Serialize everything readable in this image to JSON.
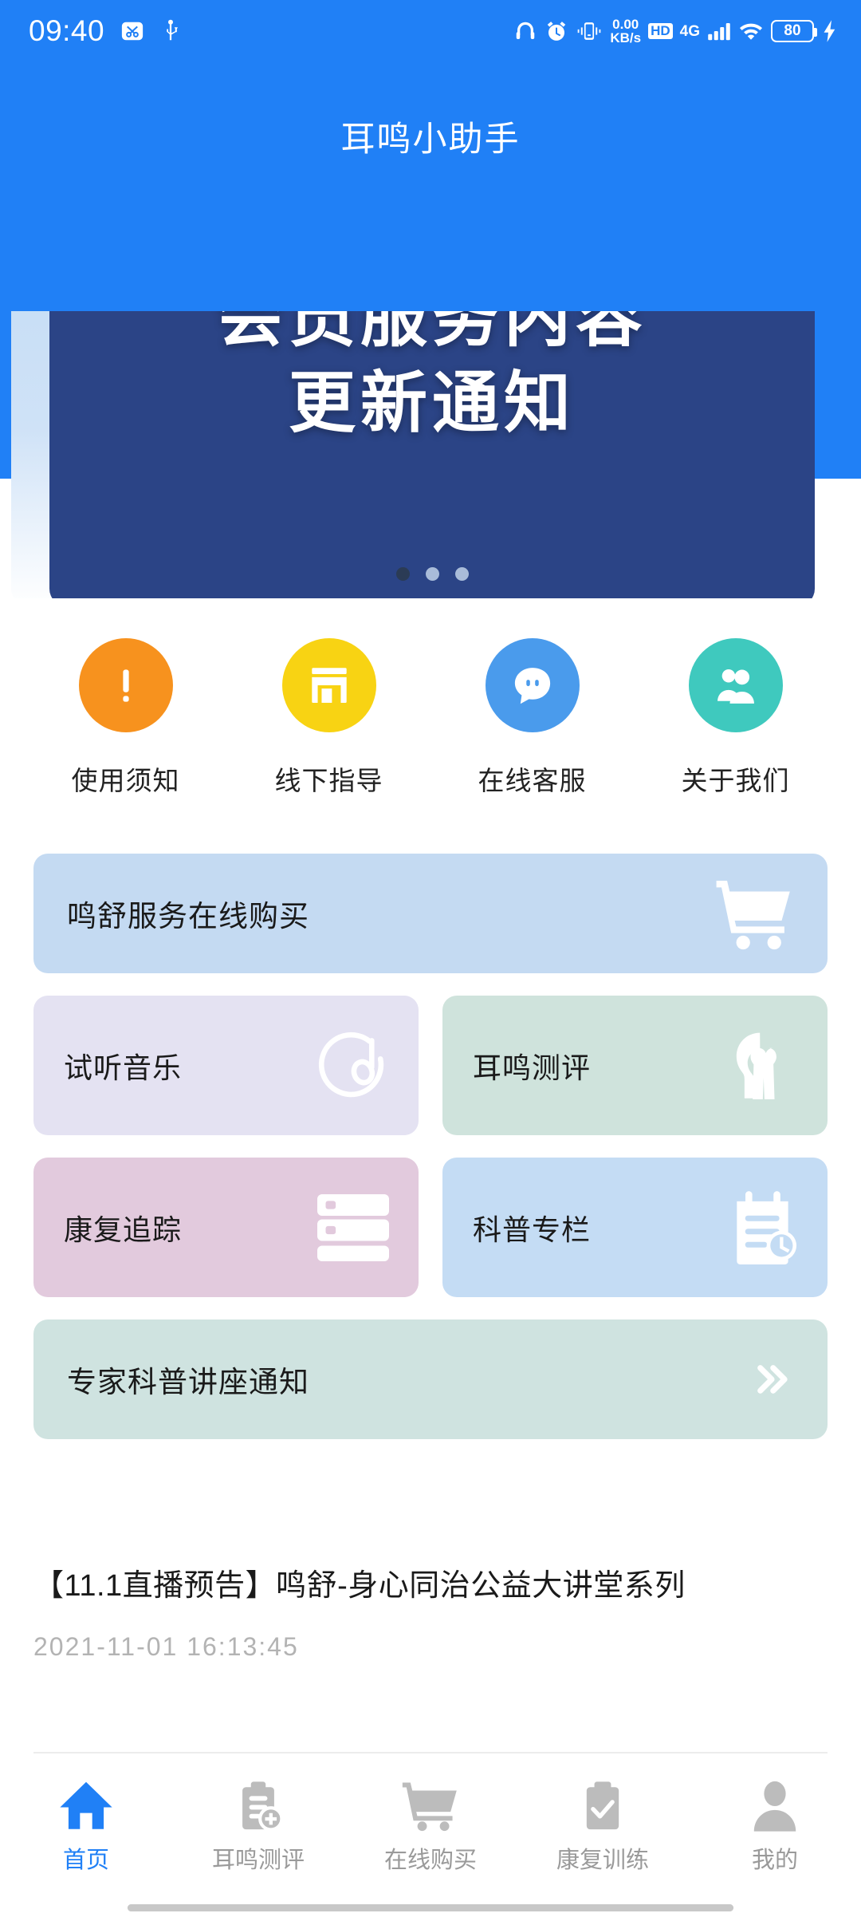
{
  "status_bar": {
    "time": "09:40",
    "icons_left": [
      "screenshot-icon",
      "usb-icon"
    ],
    "net_speed_value": "0.00",
    "net_speed_unit": "KB/s",
    "hd_label": "HD",
    "network_type": "4G",
    "battery_level": "80",
    "icons_right": [
      "headphone-icon",
      "alarm-clock-icon",
      "vibrate-icon",
      "wifi-icon",
      "charging-bolt-icon"
    ]
  },
  "header": {
    "title": "耳鸣小助手",
    "bg_color": "#2080F6"
  },
  "carousel": {
    "banner_line1": "会员服务内容",
    "banner_line2": "更新通知",
    "banner_bg": "#2b4486",
    "dot_count": 3,
    "active_dot": 0
  },
  "quick_actions": [
    {
      "label": "使用须知",
      "icon": "exclamation-icon",
      "color": "#F7921E"
    },
    {
      "label": "线下指导",
      "icon": "store-icon",
      "color": "#F8D313"
    },
    {
      "label": "在线客服",
      "icon": "chat-bubble-icon",
      "color": "#4A9BEC"
    },
    {
      "label": "关于我们",
      "icon": "people-icon",
      "color": "#3FC9BE"
    }
  ],
  "cards": {
    "purchase": {
      "title": "鸣舒服务在线购买",
      "icon": "shopping-cart-icon",
      "color": "#c4daf2"
    },
    "music": {
      "title": "试听音乐",
      "icon": "music-note-icon",
      "color": "#e4e2f2"
    },
    "assess": {
      "title": "耳鸣测评",
      "icon": "head-heart-icon",
      "color": "#cfe3dc"
    },
    "tracking": {
      "title": "康复追踪",
      "icon": "list-rows-icon",
      "color": "#e2cadd"
    },
    "science": {
      "title": "科普专栏",
      "icon": "notepad-clock-icon",
      "color": "#c4dcf4"
    },
    "lecture": {
      "title": "专家科普讲座通知",
      "icon": "double-chevron-right-icon",
      "color": "#cfe3e0"
    }
  },
  "news": {
    "title": "【11.1直播预告】鸣舒-身心同治公益大讲堂系列",
    "date": "2021-11-01 16:13:45"
  },
  "tabbar": {
    "active_color": "#2080F6",
    "inactive_color": "#9a9a9a",
    "items": [
      {
        "label": "首页",
        "icon": "home-icon",
        "active": true
      },
      {
        "label": "耳鸣测评",
        "icon": "clipboard-plus-icon",
        "active": false
      },
      {
        "label": "在线购买",
        "icon": "cart-icon",
        "active": false
      },
      {
        "label": "康复训练",
        "icon": "clipboard-check-icon",
        "active": false
      },
      {
        "label": "我的",
        "icon": "user-icon",
        "active": false
      }
    ]
  }
}
